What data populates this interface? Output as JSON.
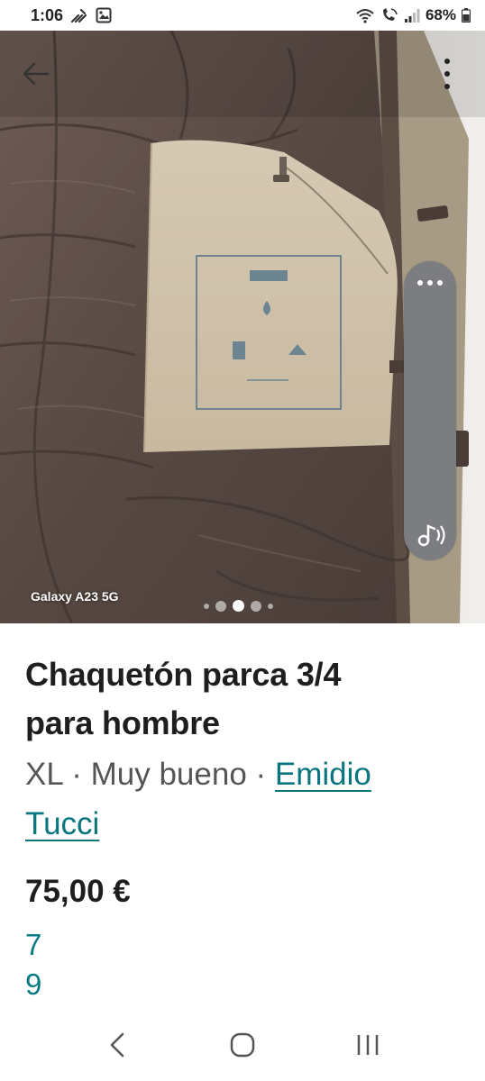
{
  "status_bar": {
    "time": "1:06",
    "battery_percent": "68%",
    "icons": [
      "bolt-notification-icon",
      "gallery-notification-icon",
      "wifi-icon",
      "call-icon",
      "signal-icon",
      "battery-icon"
    ]
  },
  "photo": {
    "watermark": "Galaxy A23 5G",
    "pager": {
      "total": 5,
      "active": 3
    },
    "icons": [
      "back-arrow-icon",
      "more-vert-icon",
      "overflow-dots-icon",
      "sound-icon"
    ]
  },
  "listing": {
    "title_line1": "Chaquetón parca 3/4",
    "title_line2": "para hombre",
    "size": "XL",
    "separator": " · ",
    "condition": "Muy bueno",
    "brand_part1": "Emidio",
    "brand_part2": "Tucci",
    "price": "75,00 €",
    "number1": "7",
    "number2": "9"
  },
  "colors": {
    "accent": "#0a7c86",
    "text": "#1e1e1e",
    "muted": "#555555"
  },
  "nav_bar": {
    "icons": [
      "nav-back-icon",
      "nav-home-icon",
      "nav-recents-icon"
    ]
  }
}
